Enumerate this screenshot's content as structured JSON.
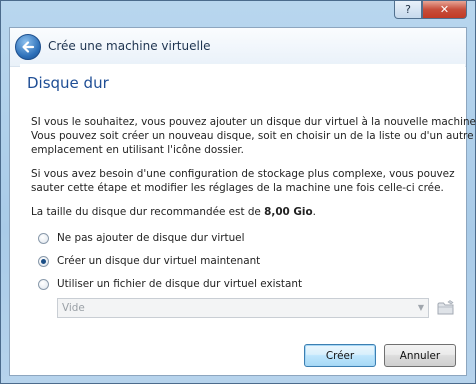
{
  "window": {
    "help_glyph": "?",
    "close_glyph": "✕"
  },
  "header": {
    "title": "Crée une machine virtuelle"
  },
  "page": {
    "heading": "Disque dur",
    "paragraph1": [
      "SI vous le souhaitez, vous pouvez ajouter un disque dur virtuel à la nouvelle machine.",
      "Vous pouvez soit créer un nouveau disque, soit en choisir un de la liste ou d'un autre",
      "emplacement en utilisant l'icône dossier."
    ],
    "paragraph2": [
      "Si vous avez besoin d'une configuration de stockage plus complexe, vous pouvez",
      "sauter cette étape et modifier les réglages de la machine une fois celle-ci crée."
    ],
    "recommended_prefix": "La taille du disque dur recommandée est de ",
    "recommended_size": "8,00 Gio",
    "recommended_suffix": ".",
    "options": [
      {
        "label": "Ne pas ajouter de disque dur virtuel",
        "checked": false
      },
      {
        "label": "Créer un disque dur virtuel maintenant",
        "checked": true
      },
      {
        "label": "Utiliser un fichier de disque dur virtuel existant",
        "checked": false
      }
    ],
    "existing_disk_select": {
      "value": "Vide",
      "enabled": false
    }
  },
  "buttons": {
    "create": "Créer",
    "cancel": "Annuler"
  },
  "icons": {
    "back": "back-arrow-icon",
    "folder": "folder-icon"
  },
  "colors": {
    "heading": "#1f4e95",
    "accent": "#2c6fb8"
  }
}
